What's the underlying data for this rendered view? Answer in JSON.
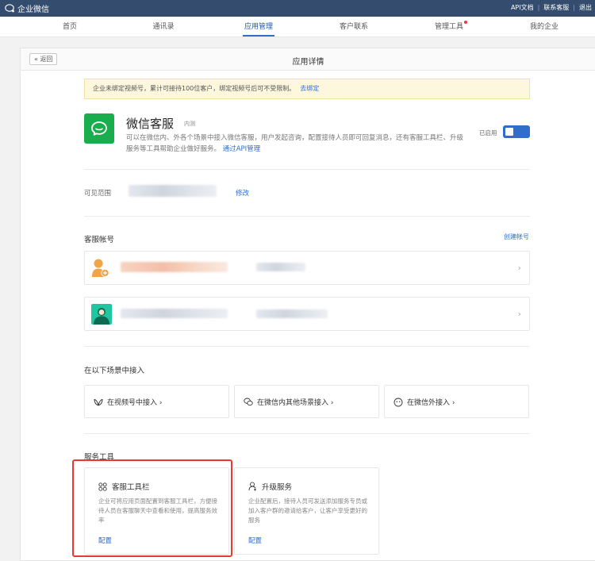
{
  "topbar": {
    "brand": "企业微信",
    "links": [
      "API文档",
      "联系客服",
      "退出"
    ]
  },
  "nav": {
    "items": [
      "首页",
      "通讯录",
      "应用管理",
      "客户联系",
      "管理工具",
      "我的企业"
    ],
    "active": "应用管理"
  },
  "panel": {
    "back_label": "« 返回",
    "title": "应用详情"
  },
  "notice": {
    "text": "企业未绑定视频号，累计可接待100位客户，绑定视频号后可不受限制。",
    "link": "去绑定"
  },
  "app": {
    "name": "微信客服",
    "tag": "内测",
    "description": "可以在微信内、外各个场景中接入微信客服，用户发起咨询，配置接待人员即可回复消息，还有客服工具栏、升级服务等工具帮助企业做好服务。",
    "api_link": "通过API管理",
    "status_label": "已启用",
    "enabled": true
  },
  "visibility": {
    "label": "可见范围",
    "edit_link": "修改"
  },
  "accounts": {
    "title": "客服帐号",
    "create_link": "创建帐号",
    "count": 2
  },
  "scenes": {
    "title": "在以下场景中接入",
    "items": [
      "在视频号中接入 ›",
      "在微信内其他场景接入 ›",
      "在微信外接入 ›"
    ]
  },
  "tools": {
    "title": "服务工具",
    "items": [
      {
        "name": "客服工具栏",
        "description": "企业可将应用页面配置到客服工具栏，方便接待人员在客服聊天中查看和使用，提高服务效率",
        "link": "配置"
      },
      {
        "name": "升级服务",
        "description": "企业配置后，接待人员可发送添加服务专员或加入客户群的邀请给客户，让客户享受更好的服务",
        "link": "配置"
      }
    ]
  },
  "colors": {
    "topbar": "#344d6e",
    "accent": "#2f6ecb",
    "app_icon": "#1aad4d",
    "highlight": "#e83a30"
  }
}
